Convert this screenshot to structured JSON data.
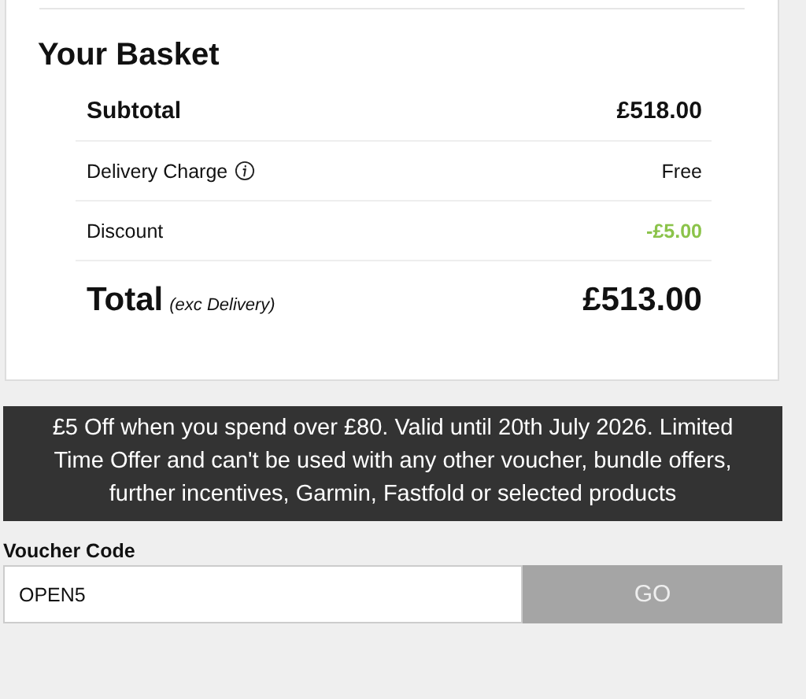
{
  "basket": {
    "title": "Your Basket",
    "rows": [
      {
        "kind": "subtotal",
        "label": "Subtotal",
        "value": "£518.00"
      },
      {
        "kind": "delivery",
        "label": "Delivery Charge",
        "value": "Free"
      },
      {
        "kind": "discount",
        "label": "Discount",
        "value": "-£5.00"
      },
      {
        "kind": "total",
        "label": "Total",
        "note": "(exc Delivery)",
        "value": "£513.00"
      }
    ]
  },
  "offer": {
    "text": "£5 Off when you spend over £80. Valid until 20th July 2026. Limited Time Offer and can't be used with any other voucher, bundle offers, further incentives, Garmin, Fastfold or selected products"
  },
  "voucher": {
    "label": "Voucher Code",
    "value": "OPEN5",
    "button": "GO"
  }
}
